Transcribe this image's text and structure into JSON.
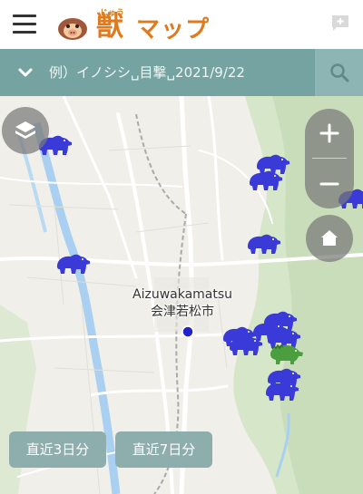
{
  "header": {
    "logo_ruby": "じゅう",
    "logo_kanji": "獣",
    "logo_kana": "マップ"
  },
  "search": {
    "placeholder": "例）イノシシ␣目撃␣2021/9/22"
  },
  "map": {
    "city_label_en": "Aizuwakamatsu",
    "city_label_ja": "会津若松市"
  },
  "filters": {
    "last3": "直近3日分",
    "last7": "直近7日分"
  },
  "colors": {
    "header_bg": "#ffffff",
    "searchbar_bg": "#74a3a2",
    "bear_marker": "#3a3ad8",
    "boar_marker": "#4a9e3f",
    "logo_orange": "#e07a1f",
    "location_dot": "#2222cc"
  },
  "icons": [
    "menu-icon",
    "boar-logo-icon",
    "chat-plus-icon",
    "chevron-down-icon",
    "search-icon",
    "layers-icon",
    "plus-icon",
    "minus-icon",
    "home-icon",
    "bear-icon",
    "boar-icon"
  ]
}
